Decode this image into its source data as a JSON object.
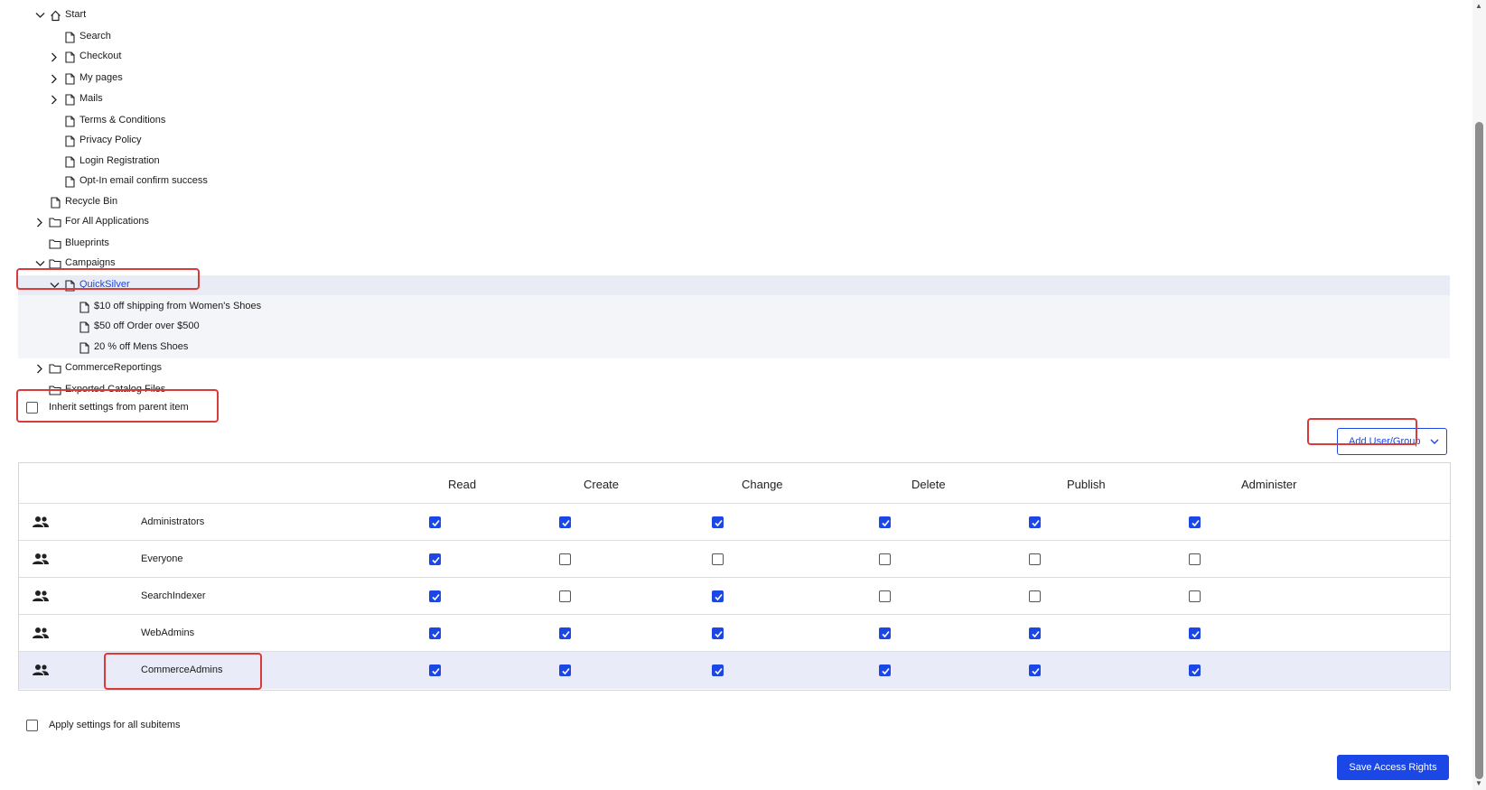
{
  "tree": {
    "items": [
      {
        "label": "Start",
        "icon": "home-icon",
        "expand": "expanded"
      },
      {
        "label": "Search",
        "icon": "page-icon",
        "expand": "none"
      },
      {
        "label": "Checkout",
        "icon": "page-icon",
        "expand": "collapsed"
      },
      {
        "label": "My pages",
        "icon": "page-icon",
        "expand": "collapsed"
      },
      {
        "label": "Mails",
        "icon": "page-icon",
        "expand": "collapsed"
      },
      {
        "label": "Terms & Conditions",
        "icon": "page-icon",
        "expand": "none"
      },
      {
        "label": "Privacy Policy",
        "icon": "page-icon",
        "expand": "none"
      },
      {
        "label": "Login Registration",
        "icon": "page-icon",
        "expand": "none"
      },
      {
        "label": "Opt-In email confirm success",
        "icon": "page-icon",
        "expand": "none"
      },
      {
        "label": "Recycle Bin",
        "icon": "page-icon",
        "expand": "none"
      },
      {
        "label": "For All Applications",
        "icon": "folder-icon",
        "expand": "collapsed"
      },
      {
        "label": "Blueprints",
        "icon": "folder-icon",
        "expand": "none"
      },
      {
        "label": "Campaigns",
        "icon": "folder-icon",
        "expand": "expanded"
      },
      {
        "label": "QuickSilver",
        "icon": "page-icon",
        "expand": "expanded",
        "selected": true
      },
      {
        "label": "$10 off shipping from Women's Shoes",
        "icon": "page-icon",
        "expand": "none"
      },
      {
        "label": "$50 off Order over $500",
        "icon": "page-icon",
        "expand": "none"
      },
      {
        "label": "20 % off Mens Shoes",
        "icon": "page-icon",
        "expand": "none"
      },
      {
        "label": "CommerceReportings",
        "icon": "folder-icon",
        "expand": "collapsed"
      },
      {
        "label": "Exported Catalog Files",
        "icon": "folder-icon",
        "expand": "none"
      }
    ]
  },
  "inherit": {
    "label": "Inherit settings from parent item",
    "checked": false
  },
  "add_button": {
    "label": "Add User/Group",
    "icon": "chevron-down-icon"
  },
  "grid": {
    "columns": [
      "Read",
      "Create",
      "Change",
      "Delete",
      "Publish",
      "Administer"
    ],
    "rows": [
      {
        "name": "Administrators",
        "icon": "group-icon",
        "perms": [
          true,
          true,
          true,
          true,
          true,
          true
        ]
      },
      {
        "name": "Everyone",
        "icon": "group-icon",
        "perms": [
          true,
          false,
          false,
          false,
          false,
          false
        ]
      },
      {
        "name": "SearchIndexer",
        "icon": "group-icon",
        "perms": [
          true,
          false,
          true,
          false,
          false,
          false
        ]
      },
      {
        "name": "WebAdmins",
        "icon": "group-icon",
        "perms": [
          true,
          true,
          true,
          true,
          true,
          true
        ]
      },
      {
        "name": "CommerceAdmins",
        "icon": "group-icon",
        "perms": [
          true,
          true,
          true,
          true,
          true,
          true
        ],
        "selected": true
      }
    ]
  },
  "apply": {
    "label": "Apply settings for all subitems",
    "checked": false
  },
  "save_button": {
    "label": "Save Access Rights"
  },
  "colors": {
    "accent": "#1a47e6",
    "highlight": "#d93b3b",
    "selected_row": "#e9ecf8"
  }
}
